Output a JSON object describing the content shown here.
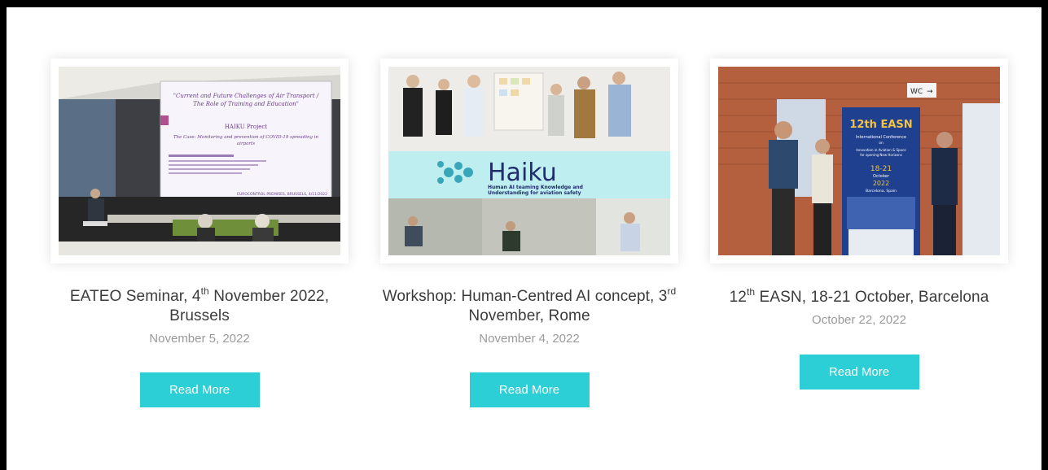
{
  "posts": [
    {
      "title_prefix": "EATEO Seminar, 4",
      "title_sup": "th",
      "title_suffix": " November 2022, Brussels",
      "date": "November 5, 2022",
      "button": "Read More",
      "image_text": {
        "slide_title": "\"Current and Future Challenges of Air Transport / The Role of Training and Education\"",
        "slide_project": "HAIKU Project",
        "slide_subtitle": "The Case: Monitoring and prevention of COVID-19 spreading in airports",
        "slide_footer": "EUROCONTROL PREMISES, BRUSSELS, 4/11/2022"
      }
    },
    {
      "title_prefix": "Workshop: Human-Centred AI concept, 3",
      "title_sup": "rd",
      "title_suffix": " November, Rome",
      "date": "November 4, 2022",
      "button": "Read More",
      "image_text": {
        "logo": "Haiku",
        "tagline_1": "Human AI teaming Knowledge and",
        "tagline_2": "Understanding for aviation safety"
      }
    },
    {
      "title_prefix": "12",
      "title_sup": "th",
      "title_suffix": " EASN, 18-21 October, Barcelona",
      "date": "October 22, 2022",
      "button": "Read More",
      "image_text": {
        "wc_sign": "WC",
        "banner_title": "12th EASN",
        "banner_sub": "International Conference",
        "banner_on": "on",
        "banner_topic": "Innovation in Aviation & Space for opening New Horizons",
        "banner_dates": "18-21",
        "banner_month": "October",
        "banner_year": "2022",
        "banner_city": "Barcelona, Spain"
      }
    }
  ],
  "colors": {
    "accent": "#2ccfd5",
    "title": "#3b3b3b",
    "date": "#9a9a9a"
  }
}
